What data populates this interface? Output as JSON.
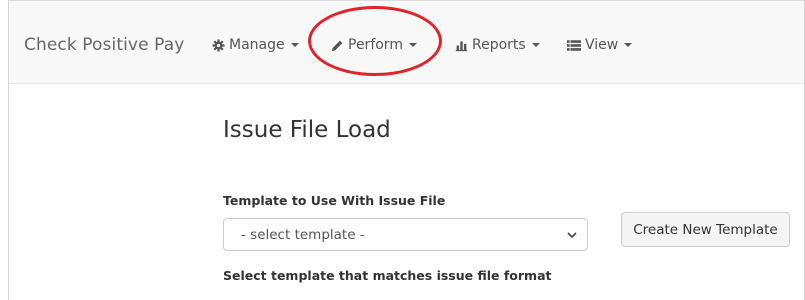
{
  "navbar": {
    "brand": "Check Positive Pay",
    "items": [
      {
        "label": "Manage",
        "icon": "gear-icon"
      },
      {
        "label": "Perform",
        "icon": "pencil-icon"
      },
      {
        "label": "Reports",
        "icon": "bar-chart-icon"
      },
      {
        "label": "View",
        "icon": "list-icon"
      }
    ]
  },
  "highlight": {
    "color": "#e1242a",
    "target": "Perform"
  },
  "main": {
    "title": "Issue File Load",
    "template_label": "Template to Use With Issue File",
    "template_select": {
      "selected": "- select template -"
    },
    "create_button_label": "Create New Template",
    "help_text": "Select template that matches issue file format"
  }
}
